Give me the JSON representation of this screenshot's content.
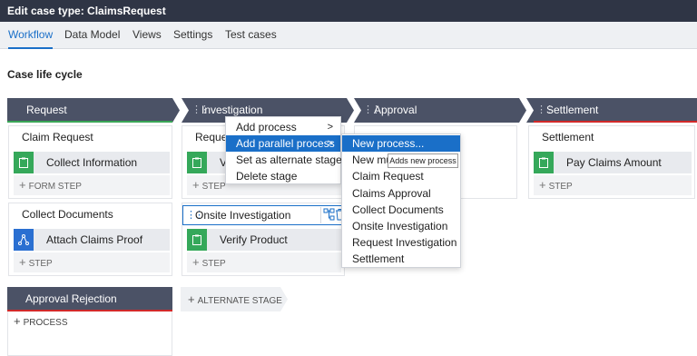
{
  "window": {
    "title": "Edit case type: ClaimsRequest"
  },
  "tabs": [
    {
      "label": "Workflow",
      "active": true
    },
    {
      "label": "Data Model"
    },
    {
      "label": "Views"
    },
    {
      "label": "Settings"
    },
    {
      "label": "Test cases"
    }
  ],
  "lifecycle": {
    "title": "Case life cycle"
  },
  "stages": [
    {
      "label": "Request",
      "color": "#4b5266",
      "accent": "#3aa657"
    },
    {
      "label": "Investigation",
      "color": "#4b5266"
    },
    {
      "label": "Approval",
      "color": "#4b5266"
    },
    {
      "label": "Settlement",
      "color": "#4b5266",
      "accent": "#d12a2a"
    }
  ],
  "request": {
    "processes": [
      {
        "title": "Claim Request",
        "step": "Collect Information",
        "add": "FORM STEP"
      },
      {
        "title": "Collect Documents",
        "step": "Attach Claims Proof",
        "add": "STEP"
      }
    ]
  },
  "investigation": {
    "process1": {
      "title_partial": "Reques",
      "step_partial": "Ve",
      "add": "STEP"
    },
    "process2": {
      "edit_value": "Onsite Investigation",
      "step": "Verify Product",
      "add": "STEP"
    }
  },
  "settlement": {
    "process": {
      "title": "Settlement",
      "step": "Pay Claims Amount",
      "add": "STEP"
    }
  },
  "alternate": {
    "stage": {
      "label": "Approval Rejection",
      "accent": "#d12a2a"
    },
    "add_process": "PROCESS",
    "add_stage": "ALTERNATE STAGE"
  },
  "context_menu": {
    "items": [
      "Add process",
      "Add parallel process",
      "Set as alternate stage",
      "Delete stage"
    ]
  },
  "submenu": {
    "items": [
      "New process...",
      "New mu",
      "Claim Request",
      "Claims Approval",
      "Collect Documents",
      "Onsite Investigation",
      "Request Investigation",
      "Settlement"
    ],
    "tooltip": "Adds new process"
  },
  "colors": {
    "accent_blue": "#1a6fc8",
    "step_green": "#35a85a",
    "step_blue": "#2a6fd1",
    "header_dark": "#2f3545"
  },
  "icons": {
    "form_step": "clipboard-icon",
    "attach_step": "share-nodes-icon",
    "add": "plus-icon"
  }
}
